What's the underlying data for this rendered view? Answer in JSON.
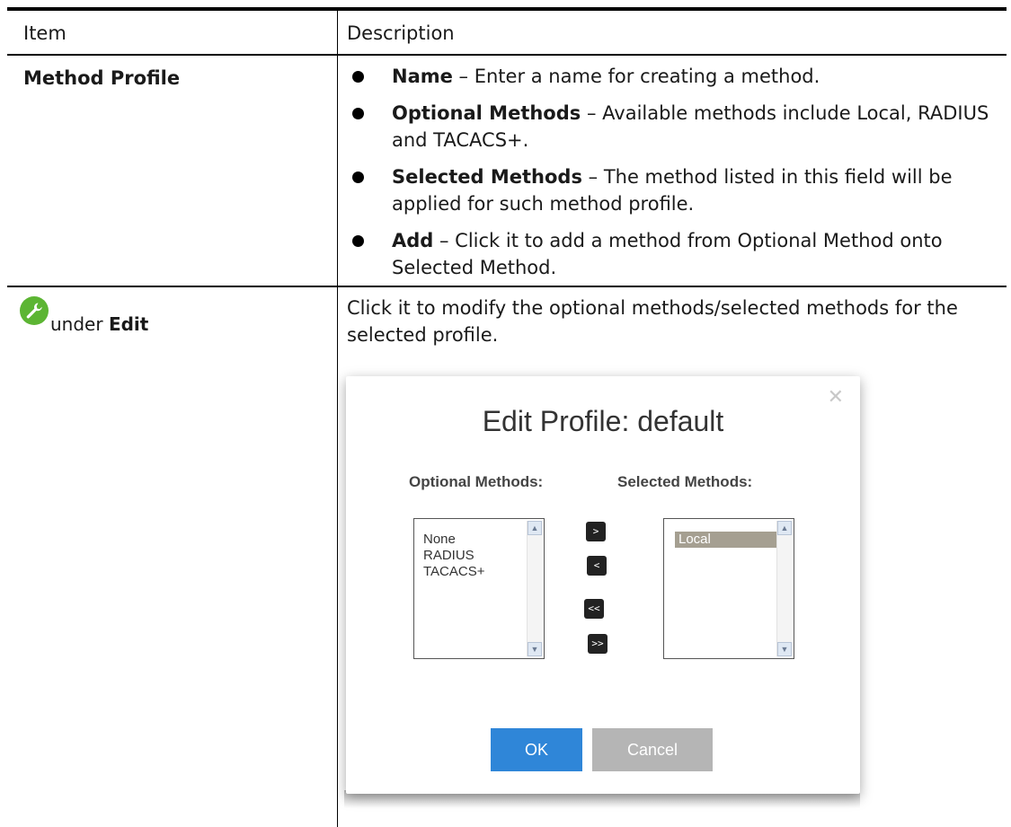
{
  "table": {
    "header": {
      "item": "Item",
      "description": "Description"
    },
    "rows": [
      {
        "item": "Method Profile",
        "bullets": [
          {
            "term": "Name",
            "text": " – Enter a name for creating a method."
          },
          {
            "term": "Optional Methods",
            "text": " – Available methods include Local, RADIUS and TACACS+."
          },
          {
            "term": "Selected Methods",
            "text": " – The method listed in this field will be applied for such method profile."
          },
          {
            "term": "Add",
            "text": " – Click it to add a method from Optional Method onto Selected Method."
          }
        ]
      },
      {
        "item_icon": "wrench-icon",
        "item_prefix": "under ",
        "item_bold": "Edit",
        "description": "Click it to modify the optional methods/selected methods for the selected profile."
      }
    ]
  },
  "dialog": {
    "title": "Edit Profile: default",
    "close_icon": "close-icon",
    "optional_heading": "Optional Methods:",
    "selected_heading": "Selected Methods:",
    "optional_items": [
      "None",
      "RADIUS",
      "TACACS+"
    ],
    "selected_items": [
      "Local"
    ],
    "move_buttons": [
      ">",
      "<",
      "<<",
      ">>"
    ],
    "ok_label": "OK",
    "cancel_label": "Cancel"
  },
  "colors": {
    "icon_green": "#5cb533",
    "ok_blue": "#2f86d8",
    "selected_item": "#a59f91"
  }
}
